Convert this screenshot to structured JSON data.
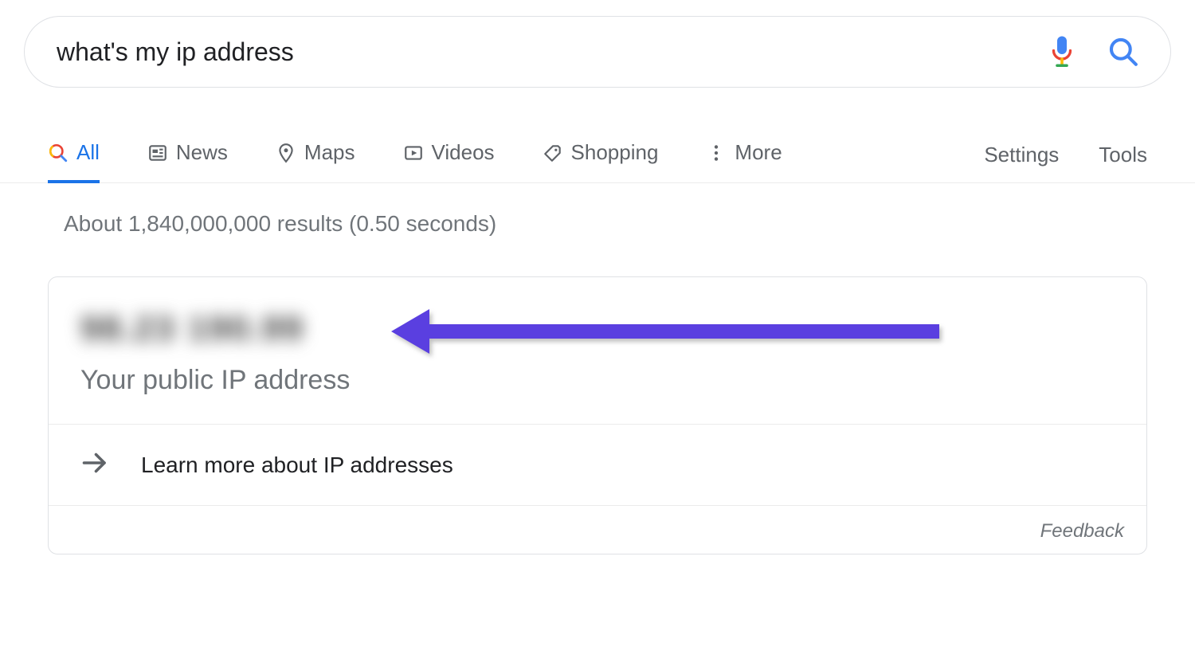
{
  "search": {
    "query": "what's my ip address"
  },
  "tabs": {
    "all": "All",
    "news": "News",
    "maps": "Maps",
    "videos": "Videos",
    "shopping": "Shopping",
    "more": "More"
  },
  "controls": {
    "settings": "Settings",
    "tools": "Tools"
  },
  "stats": "About 1,840,000,000 results (0.50 seconds)",
  "answer": {
    "ip_masked": "98.23  190.99",
    "label": "Your public IP address",
    "learn_more": "Learn more about IP addresses"
  },
  "feedback": "Feedback"
}
